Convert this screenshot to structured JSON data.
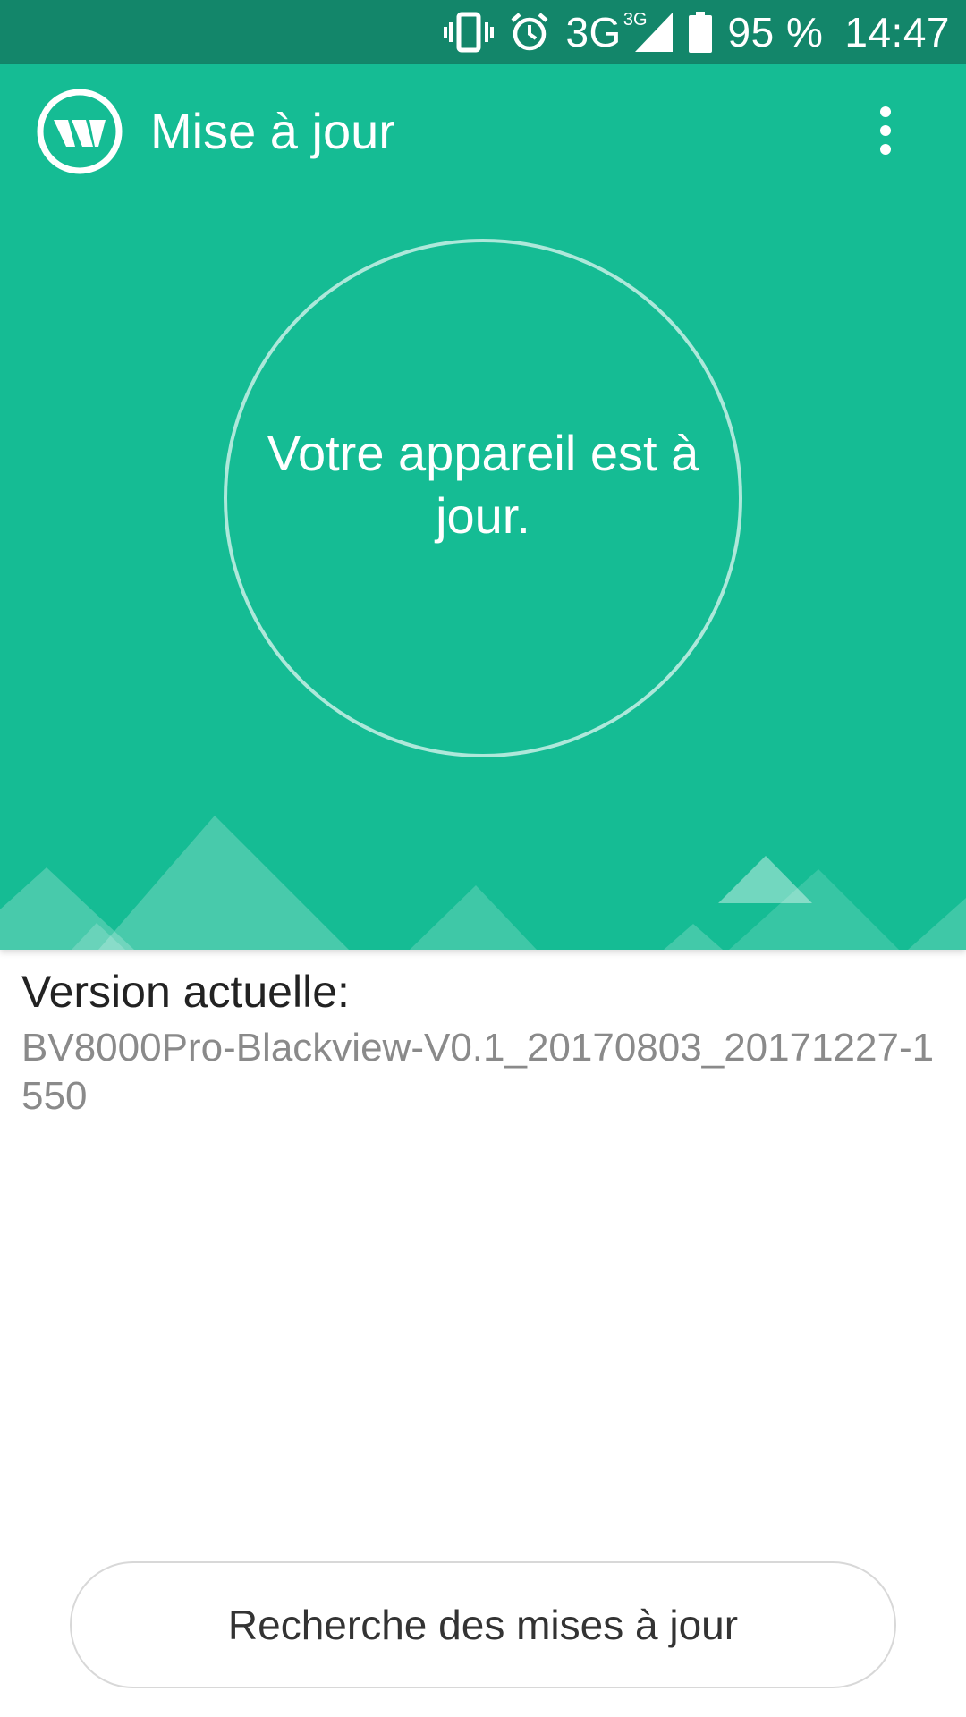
{
  "status_bar": {
    "network": "3G",
    "network_small": "3G",
    "battery": "95 %",
    "time": "14:47",
    "icons": [
      "vibrate-icon",
      "alarm-icon",
      "signal-icon",
      "battery-icon"
    ]
  },
  "app_bar": {
    "title": "Mise à jour",
    "logo_icon": "update-app-logo",
    "menu_icon": "overflow-menu-icon"
  },
  "hero": {
    "message": "Votre appareil est à jour."
  },
  "version": {
    "label": "Version actuelle:",
    "value": "BV8000Pro-Blackview-V0.1_20170803_20171227-1550"
  },
  "actions": {
    "check_button": "Recherche des mises à jour"
  },
  "colors": {
    "status_bar": "#13866a",
    "hero": "#15bc94",
    "text_primary": "#222222",
    "text_secondary": "#8a8a8a"
  }
}
